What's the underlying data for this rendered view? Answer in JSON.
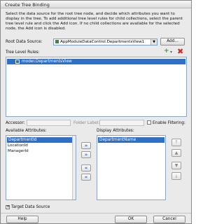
{
  "window": {
    "title": "Create Tree Binding"
  },
  "description": "Select the data source for the root tree node, and decide which attributes you want to display in the tree. To add additional tree level rules for child collections, select the parent tree level rule and click the Add icon. If no child collections are available for the selected node, the Add icon is disabled.",
  "root_data_source": {
    "label": "Root Data Source:",
    "value": "AppModuleDataControl.DepartmentsView1",
    "add_label": "Add..."
  },
  "tree_level_rules": {
    "label": "Tree Level Rules:",
    "items": [
      "model.DepartmentsView"
    ]
  },
  "accessor": {
    "label": "Accessor:",
    "value": ""
  },
  "folder_label": {
    "label": "Folder Label:",
    "value": ""
  },
  "enable_filtering": {
    "label": "Enable Filtering:",
    "checked": false
  },
  "available_attributes": {
    "label": "Available Attributes:",
    "items": [
      "DepartmentId",
      "LocationId",
      "ManagerId"
    ],
    "selected": "DepartmentId"
  },
  "display_attributes": {
    "label": "Display Attributes:",
    "items": [
      "DepartmentName"
    ],
    "selected": "DepartmentName"
  },
  "target_data_source": {
    "label": "Target Data Source"
  },
  "footer": {
    "help_label": "Help",
    "ok_label": "OK",
    "cancel_label": "Cancel"
  },
  "colors": {
    "selection": "#2f6fc4",
    "add_icon": "#3a9a3a",
    "delete_icon": "#d02a2a"
  }
}
